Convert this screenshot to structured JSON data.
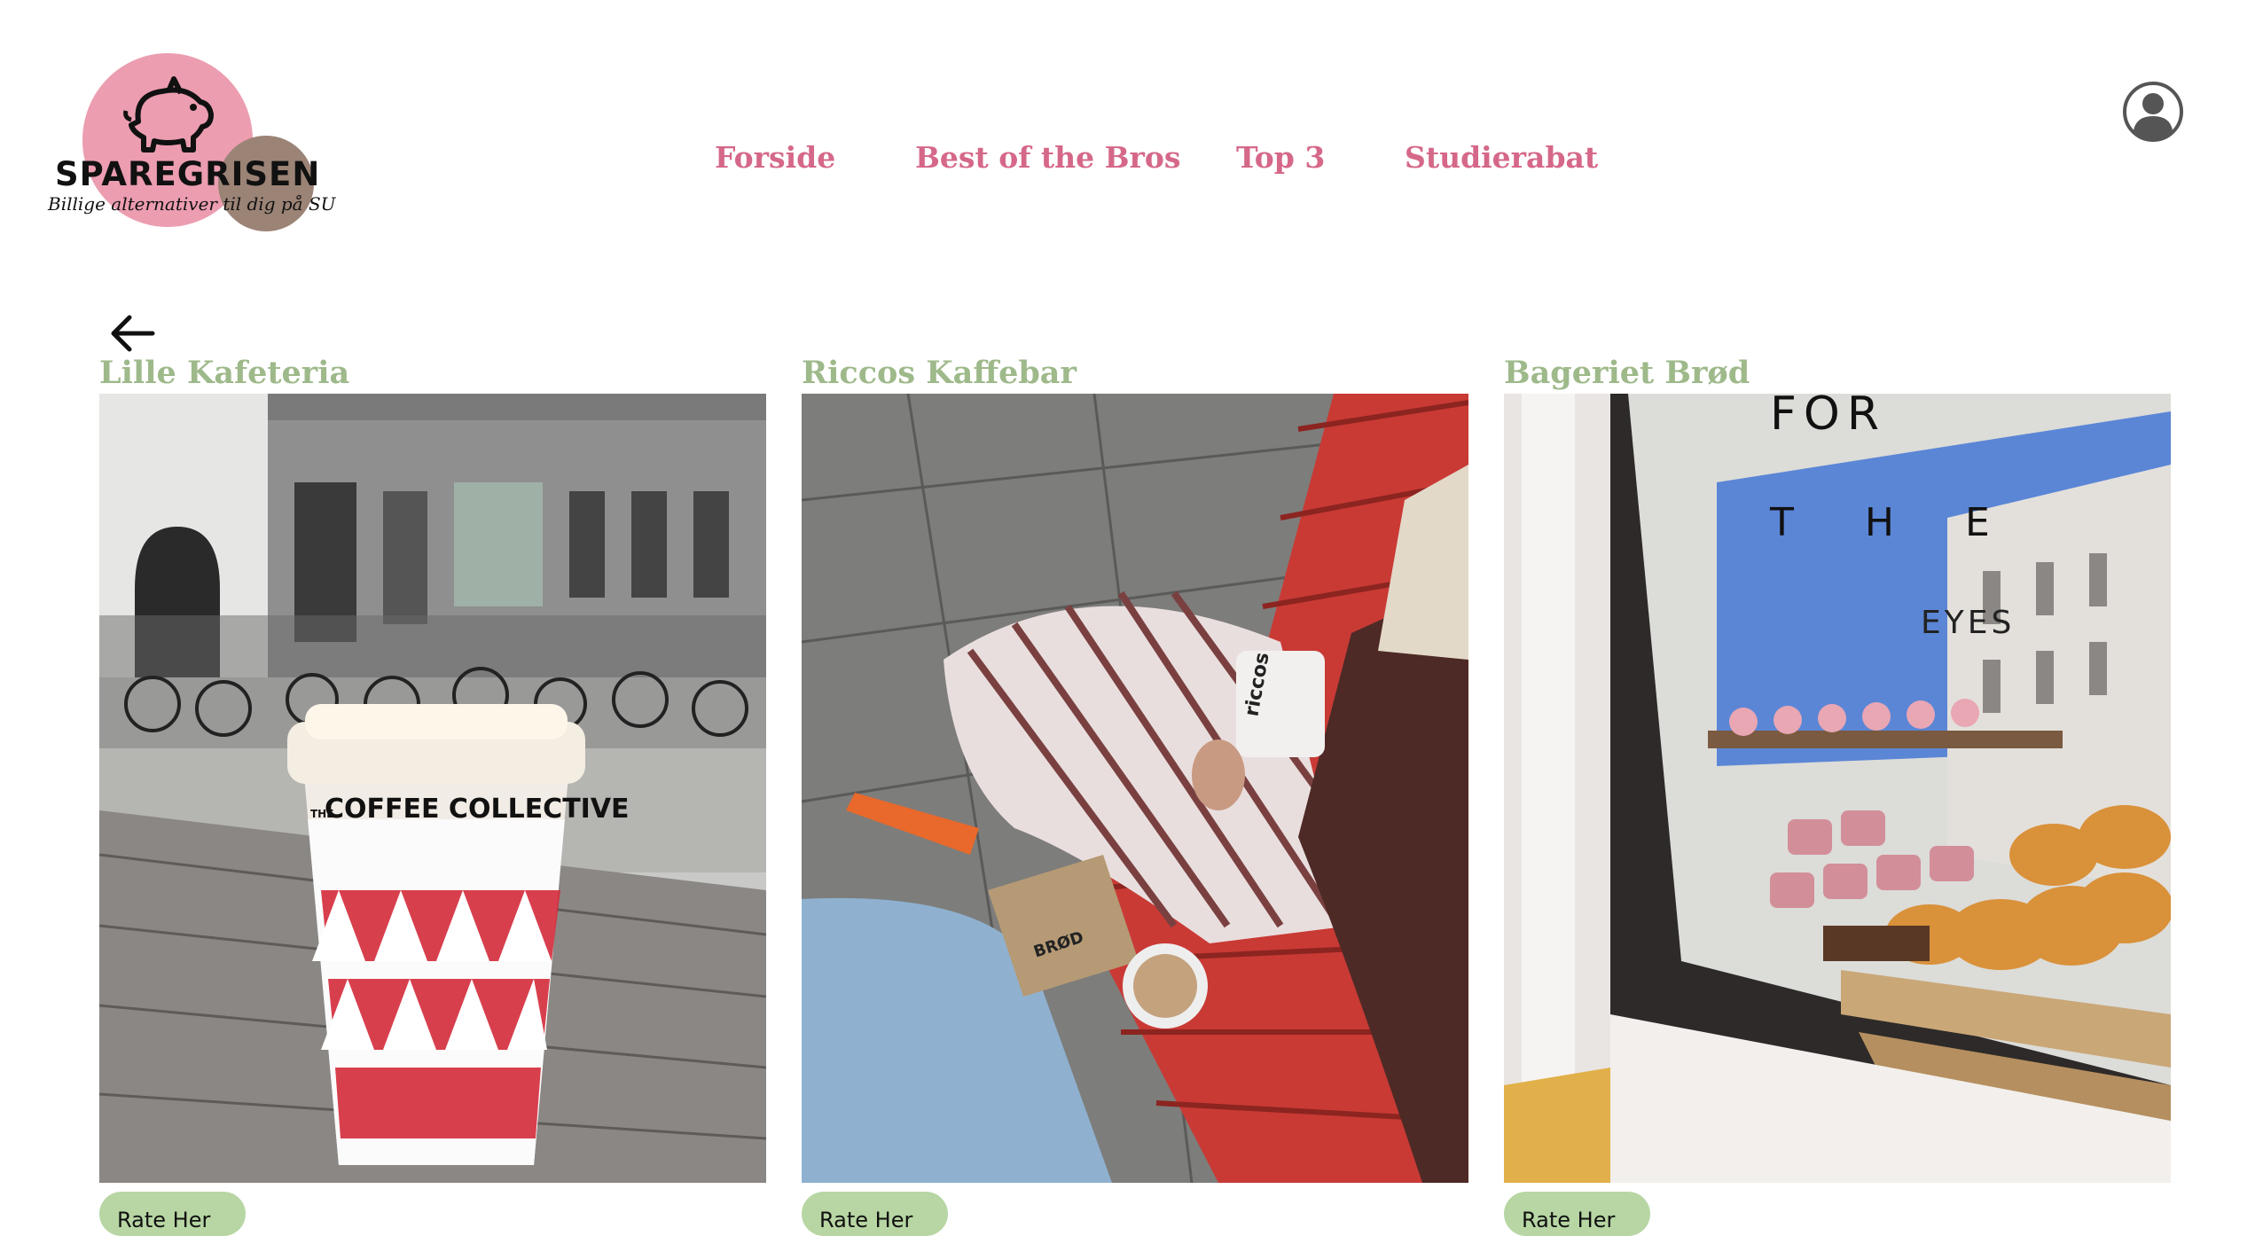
{
  "logo": {
    "name": "SPAREGRISEN",
    "tagline": "Billige alternativer til dig på SU"
  },
  "nav": {
    "items": [
      {
        "label": "Forside"
      },
      {
        "label": "Best of the Bros"
      },
      {
        "label": "Top 3"
      },
      {
        "label": "Studierabat"
      }
    ]
  },
  "cards": [
    {
      "title": "Lille Kafeteria",
      "cup_brand_top": "THE",
      "cup_brand": "COFFEE COLLECTIVE",
      "button_label": "Rate Her"
    },
    {
      "title": "Riccos Kaffebar",
      "cup_brand": "riccos",
      "bag_label": "BRØD",
      "button_label": "Rate Her"
    },
    {
      "title": "Bageriet Brød",
      "window_text": [
        "FOR",
        "THE",
        "EYES"
      ],
      "button_label": "Rate Her"
    }
  ],
  "colors": {
    "nav_pink": "#d56888",
    "title_green": "#9eb98a",
    "button_green": "#b7d6a3",
    "logo_pink": "#ec9db0",
    "logo_brown": "#9b8376"
  },
  "icons": {
    "account": "account-icon",
    "back": "arrow-left-icon",
    "logo": "pig-icon"
  }
}
